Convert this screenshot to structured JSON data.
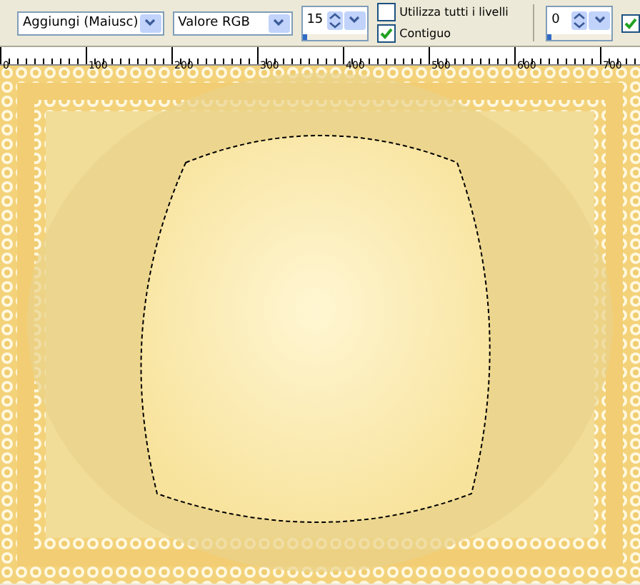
{
  "toolbar": {
    "mode_dropdown": {
      "value": "Aggiungi (Maiusc)"
    },
    "match_dropdown": {
      "value": "Valore RGB"
    },
    "tolerance": {
      "value": "15",
      "level": 0.05
    },
    "checkboxes": [
      {
        "label": "Utilizza tutti i livelli",
        "checked": false
      },
      {
        "label": "Contiguo",
        "checked": true
      }
    ],
    "feather": {
      "value": "0",
      "level": 0
    },
    "edge_checkbox": {
      "checked": true
    }
  },
  "ruler": {
    "labels": [
      "0",
      "100",
      "200",
      "300",
      "400",
      "500",
      "600",
      "700"
    ]
  }
}
